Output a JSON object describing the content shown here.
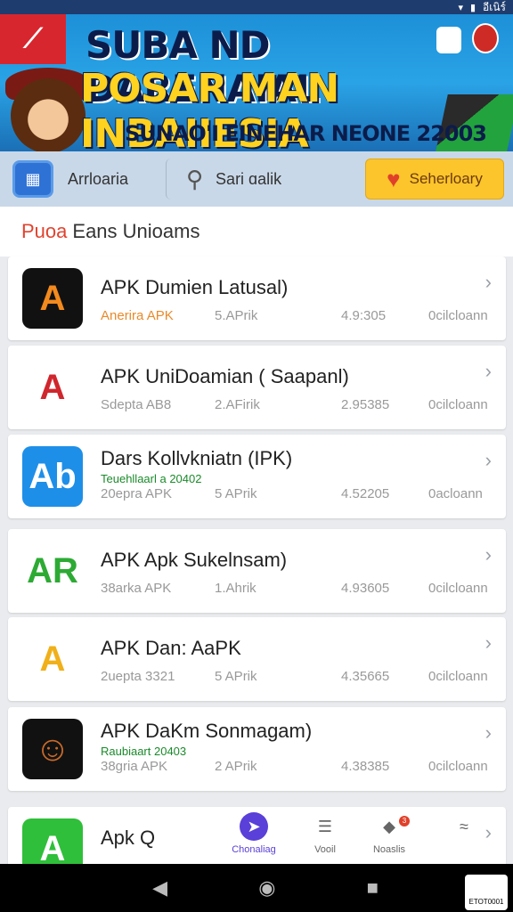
{
  "status_bar": {
    "time": "อีเนิร์"
  },
  "banner": {
    "line1": "SUBA ND DARENAIAL",
    "line2": "POSAR MAN INBAIIESIA",
    "line3": "SUNAO'I EINEHAR NEONE 22003"
  },
  "actions": {
    "apps_label": "Arrloaria",
    "search_label": "Sari ɑalik",
    "fav_label": "Seherloary"
  },
  "section": {
    "accent": "Puoa",
    "title": "Eans Unioams"
  },
  "apps": [
    {
      "name": "APK Dumien Latusal)",
      "sub": "",
      "col1": "Anerira APK",
      "col2": "5.APrik",
      "col3": "4.9:305",
      "col4": "0cilcloann",
      "col1_color": "#e88a2a",
      "icon_text": "A",
      "icon_bg": "#111111",
      "icon_fg": "#f28a1e"
    },
    {
      "name": "APK UniDoamian ( Saapanl)",
      "sub": "",
      "col1": "Sdepta AB8",
      "col2": "2.AFirik",
      "col3": "2.95385",
      "col4": "0cilcloann",
      "col1_color": "#999999",
      "icon_text": "A",
      "icon_bg": "#ffffff",
      "icon_fg": "#d0262d"
    },
    {
      "name": "Dars Kollvkniatn (IPK)",
      "sub": "Teuehllaarl a 20402",
      "col1": "20epra APK",
      "col2": "5 APrik",
      "col3": "4.52205",
      "col4": "0acloann",
      "col1_color": "#999999",
      "icon_text": "Ab",
      "icon_bg": "#1e8fe8",
      "icon_fg": "#ffffff"
    },
    {
      "name": "APK Apk Sukelnsam)",
      "sub": "",
      "col1": "38arka APK",
      "col2": "1.Ahrik",
      "col3": "4.93605",
      "col4": "0cilcloann",
      "col1_color": "#999999",
      "icon_text": "AR",
      "icon_bg": "#ffffff",
      "icon_fg": "#2daa34"
    },
    {
      "name": "APK Dan: AaPK",
      "sub": "",
      "col1": "2uepta 3321",
      "col2": "5 APrik",
      "col3": "4.35665",
      "col4": "0cilcloann",
      "col1_color": "#999999",
      "icon_text": "A",
      "icon_bg": "#ffffff",
      "icon_fg": "#f0b01a"
    },
    {
      "name": "APK DaKm Sonmagam)",
      "sub": "Raubiaart 20403",
      "col1": "38gria APK",
      "col2": "2 APrik",
      "col3": "4.38385",
      "col4": "0cilcloann",
      "col1_color": "#999999",
      "icon_text": "☺",
      "icon_bg": "#111111",
      "icon_fg": "#c96a2a"
    },
    {
      "name": "Apk Q",
      "sub": "",
      "col1": "",
      "col2": "",
      "col3": "",
      "col4": "",
      "col1_color": "#999999",
      "icon_text": "A",
      "icon_bg": "#2fbf3a",
      "icon_fg": "#ffffff"
    }
  ],
  "bottom_nav": [
    {
      "label": "Chonaliag",
      "icon": "play-icon"
    },
    {
      "label": "Vooil",
      "icon": "list-icon"
    },
    {
      "label": "Noaslis",
      "icon": "notification-icon",
      "badge": "3"
    },
    {
      "label": "",
      "icon": "map-icon"
    }
  ],
  "corner_tag": "ETOT0001"
}
